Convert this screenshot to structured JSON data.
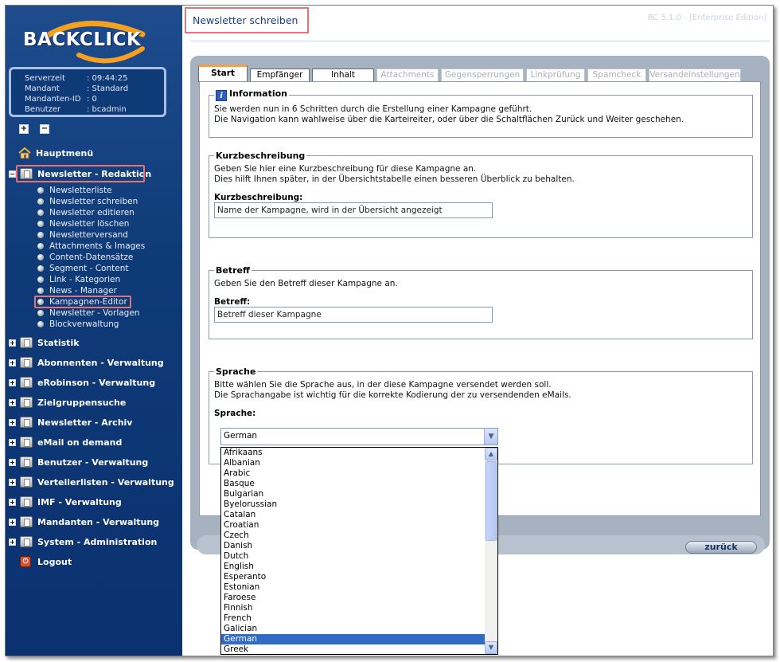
{
  "brand": {
    "logo": "BACKCLICK"
  },
  "server_info": {
    "rows": [
      {
        "key": "Serverzeit",
        "value": ": 09:44:25"
      },
      {
        "key": "Mandant",
        "value": ": Standard"
      },
      {
        "key": "Mandanten-ID",
        "value": ": 0"
      },
      {
        "key": "Benutzer",
        "value": ": bcadmin"
      }
    ]
  },
  "expand_controls": {
    "expand": "+",
    "collapse": "−"
  },
  "menu": {
    "hauptmenue": "Hauptmenü",
    "newsletter_redaktion": "Newsletter - Redaktion",
    "sub_items": [
      "Newsletterliste",
      "Newsletter schreiben",
      "Newsletter editieren",
      "Newsletter löschen",
      "Newsletterversand",
      "Attachments & Images",
      "Content-Datensätze",
      "Segment - Content",
      "Link - Kategorien",
      "News - Manager",
      "Kampagnen-Editor",
      "Newsletter - Vorlagen",
      "Blockverwaltung"
    ],
    "groups": [
      "Statistik",
      "Abonnenten - Verwaltung",
      "eRobinson - Verwaltung",
      "Zielgruppensuche",
      "Newsletter - Archiv",
      "eMail on demand",
      "Benutzer - Verwaltung",
      "Verteilerlisten - Verwaltung",
      "IMF - Verwaltung",
      "Mandanten - Verwaltung",
      "System - Administration"
    ],
    "logout": "Logout"
  },
  "header": {
    "title": "Newsletter schreiben",
    "version": "BC 5.1.0 - [Enterprise Edition]"
  },
  "tabs": [
    {
      "label": "Start",
      "state": "active"
    },
    {
      "label": "Empfänger",
      "state": "enabled"
    },
    {
      "label": "Inhalt",
      "state": "enabled"
    },
    {
      "label": "Attachments",
      "state": "disabled"
    },
    {
      "label": "Gegensperrungen",
      "state": "disabled"
    },
    {
      "label": "Linkprüfung",
      "state": "disabled"
    },
    {
      "label": "Spamcheck",
      "state": "disabled"
    },
    {
      "label": "Versandeinstellungen",
      "state": "disabled"
    }
  ],
  "sections": {
    "information": {
      "legend": "Information",
      "line1": "Sie werden nun in 6 Schritten durch die Erstellung einer Kampagne geführt.",
      "line2": "Die Navigation kann wahlweise über die Karteireiter, oder über die Schaltflächen Zurück und Weiter geschehen."
    },
    "kurzbeschreibung": {
      "legend": "Kurzbeschreibung",
      "line1": "Geben Sie hier eine Kurzbeschreibung für diese Kampagne an.",
      "line2": "Dies hilft Ihnen später, in der Übersichtstabelle einen besseren Überblick zu behalten.",
      "label": "Kurzbeschreibung:",
      "value": "Name der Kampagne, wird in der Übersicht angezeigt"
    },
    "betreff": {
      "legend": "Betreff",
      "line1": "Geben Sie den Betreff dieser Kampagne an.",
      "label": "Betreff:",
      "value": "Betreff dieser Kampagne"
    },
    "sprache": {
      "legend": "Sprache",
      "line1": "Bitte wählen Sie die Sprache aus, in der diese Kampagne versendet werden soll.",
      "line2": "Die Sprachangabe ist wichtig für die korrekte Kodierung der zu versendenden eMails.",
      "label": "Sprache:",
      "selected": "German",
      "options": [
        "Afrikaans",
        "Albanian",
        "Arabic",
        "Basque",
        "Bulgarian",
        "Byelorussian",
        "Catalan",
        "Croatian",
        "Czech",
        "Danish",
        "Dutch",
        "English",
        "Esperanto",
        "Estonian",
        "Faroese",
        "Finnish",
        "French",
        "Galician",
        "German",
        "Greek"
      ]
    }
  },
  "buttons": {
    "back": "zurück"
  },
  "colors": {
    "sidebar": "#0f3a78",
    "highlight": "#e0747a",
    "active_tab_accent": "#f2a04f",
    "selection": "#316ac5"
  }
}
